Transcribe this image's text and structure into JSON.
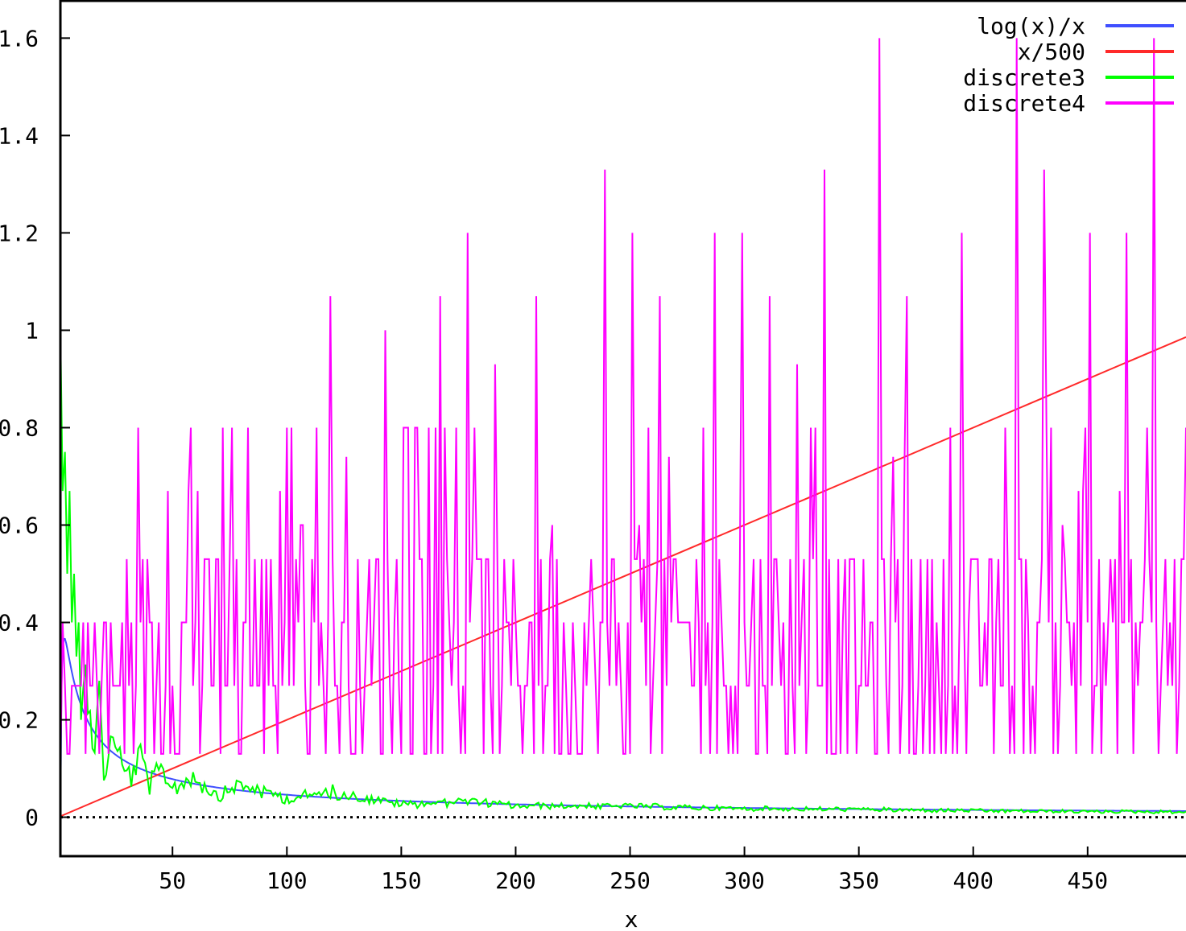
{
  "chart_data": {
    "type": "line",
    "title": "",
    "xlabel": "x",
    "ylabel": "",
    "xlim": [
      1,
      493
    ],
    "ylim": [
      -0.08,
      1.67
    ],
    "grid": false,
    "legend_position": "top-right",
    "x_ticks": [
      {
        "value": 50,
        "label": "50"
      },
      {
        "value": 100,
        "label": "100"
      },
      {
        "value": 150,
        "label": "150"
      },
      {
        "value": 200,
        "label": "200"
      },
      {
        "value": 250,
        "label": "250"
      },
      {
        "value": 300,
        "label": "300"
      },
      {
        "value": 350,
        "label": "350"
      },
      {
        "value": 400,
        "label": "400"
      },
      {
        "value": 450,
        "label": "450"
      }
    ],
    "y_ticks": [
      {
        "value": 0,
        "label": "0"
      },
      {
        "value": 0.2,
        "label": "0.2"
      },
      {
        "value": 0.4,
        "label": "0.4"
      },
      {
        "value": 0.6,
        "label": "0.6"
      },
      {
        "value": 0.8,
        "label": "0.8"
      },
      {
        "value": 1,
        "label": "1"
      },
      {
        "value": 1.2,
        "label": "1.2"
      },
      {
        "value": 1.4,
        "label": "1.4"
      },
      {
        "value": 1.6,
        "label": "1.6"
      }
    ],
    "zero_line": {
      "y": 0,
      "style": "dotted",
      "color": "#000000"
    },
    "series": [
      {
        "name": "log(x)/x",
        "color": "#3f4fff",
        "formula": "log(x)/x"
      },
      {
        "name": "x/500",
        "color": "#ff2a2a",
        "formula": "x/500"
      },
      {
        "name": "discrete3",
        "color": "#00ff00",
        "points": [
          [
            1,
            1.0
          ],
          [
            2,
            0.67
          ],
          [
            3,
            0.75
          ],
          [
            4,
            0.5
          ],
          [
            5,
            0.67
          ],
          [
            6,
            0.4
          ],
          [
            7,
            0.5
          ],
          [
            8,
            0.33
          ],
          [
            9,
            0.4
          ],
          [
            10,
            0.2
          ],
          [
            12,
            0.33
          ],
          [
            14,
            0.27
          ],
          [
            16,
            0.2
          ],
          [
            18,
            0.27
          ],
          [
            20,
            0.13
          ],
          [
            24,
            0.2
          ],
          [
            28,
            0.13
          ],
          [
            32,
            0.11
          ],
          [
            36,
            0.15
          ],
          [
            40,
            0.09
          ],
          [
            45,
            0.12
          ],
          [
            50,
            0.08
          ],
          [
            60,
            0.1
          ],
          [
            70,
            0.06
          ],
          [
            80,
            0.08
          ],
          [
            100,
            0.05
          ],
          [
            120,
            0.06
          ],
          [
            150,
            0.035
          ],
          [
            180,
            0.04
          ],
          [
            200,
            0.03
          ],
          [
            250,
            0.028
          ],
          [
            300,
            0.022
          ],
          [
            350,
            0.02
          ],
          [
            400,
            0.017
          ],
          [
            450,
            0.015
          ],
          [
            493,
            0.014
          ]
        ]
      },
      {
        "name": "discrete4",
        "color": "#ff00ff",
        "points": [
          [
            1,
            0.1
          ],
          [
            5,
            0.13
          ],
          [
            10,
            0.27
          ],
          [
            20,
            0.4
          ],
          [
            30,
            0.53
          ],
          [
            40,
            0.4
          ],
          [
            48,
            0.67
          ],
          [
            58,
            0.8
          ],
          [
            72,
            0.8
          ],
          [
            83,
            0.8
          ],
          [
            100,
            0.8
          ],
          [
            119,
            1.07
          ],
          [
            143,
            1.0
          ],
          [
            167,
            1.07
          ],
          [
            179,
            1.2
          ],
          [
            191,
            0.93
          ],
          [
            209,
            1.07
          ],
          [
            239,
            1.33
          ],
          [
            251,
            1.2
          ],
          [
            263,
            1.07
          ],
          [
            287,
            1.2
          ],
          [
            299,
            1.2
          ],
          [
            311,
            1.07
          ],
          [
            323,
            0.93
          ],
          [
            335,
            1.33
          ],
          [
            359,
            1.6
          ],
          [
            371,
            1.07
          ],
          [
            395,
            1.2
          ],
          [
            419,
            1.6
          ],
          [
            431,
            1.33
          ],
          [
            451,
            1.2
          ],
          [
            467,
            1.2
          ],
          [
            479,
            1.6
          ],
          [
            493,
            0.8
          ]
        ],
        "baseline_levels": [
          0.13,
          0.27,
          0.4,
          0.53
        ]
      }
    ]
  }
}
